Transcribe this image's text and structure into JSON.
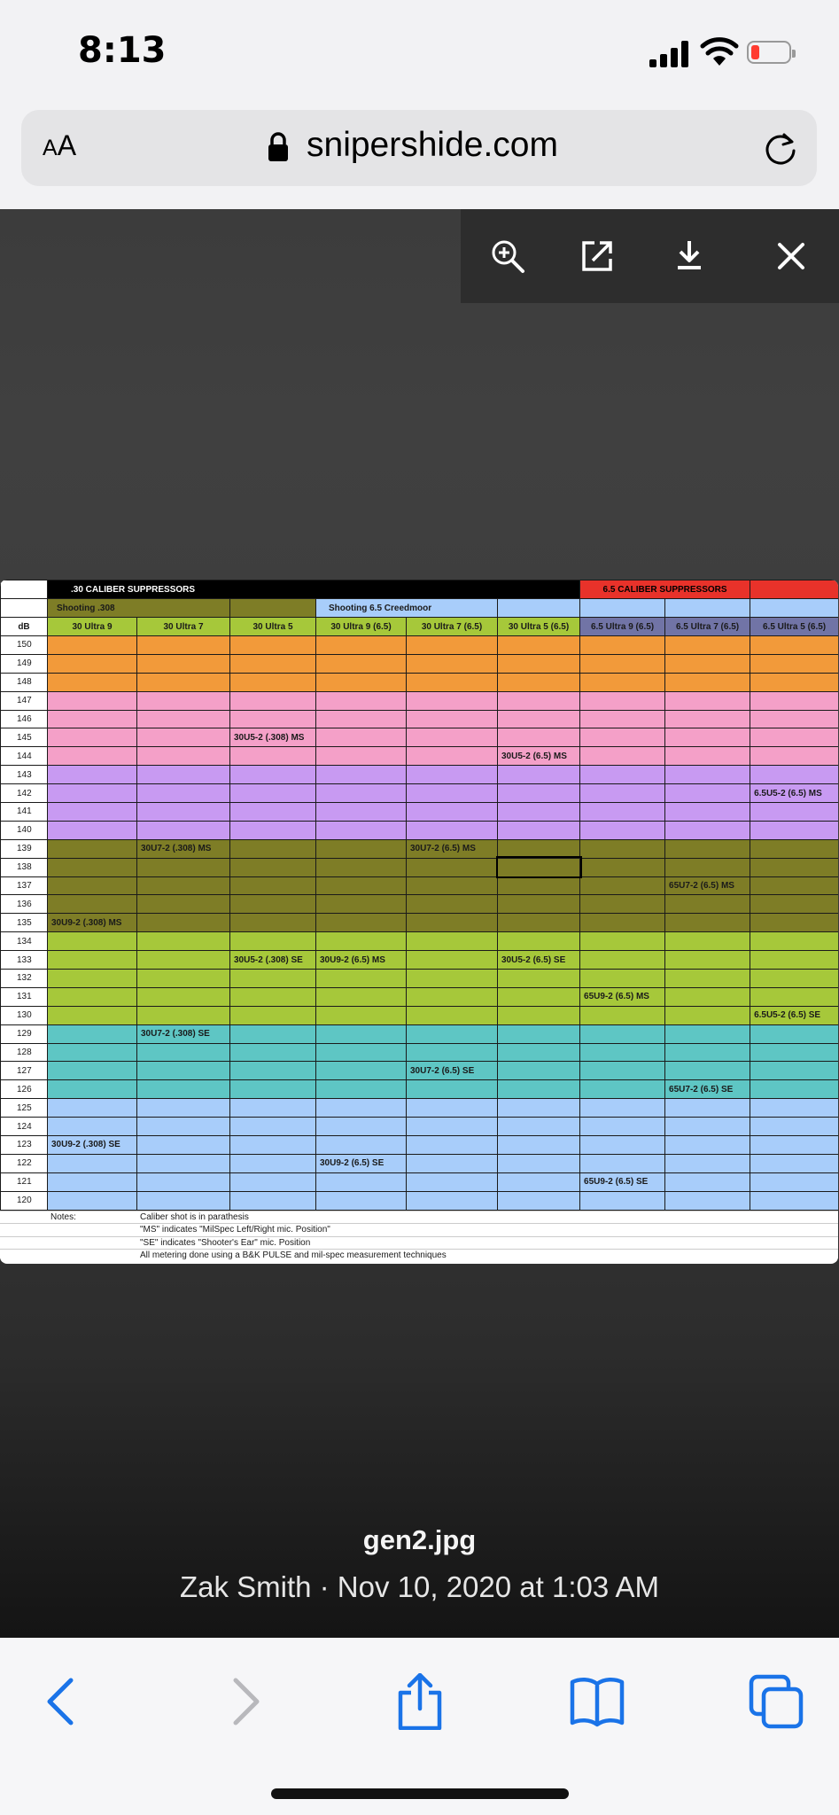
{
  "status": {
    "time": "8:13"
  },
  "browser": {
    "text_size_label": "AA",
    "url": "snipershide.com"
  },
  "viewer": {
    "file_name": "gen2.jpg",
    "meta": "Zak Smith · Nov 10, 2020 at 1:03 AM"
  },
  "sheet": {
    "group_30": ".30 CALIBER SUPPRESSORS",
    "group_65": "6.5 CALIBER SUPPRESSORS",
    "shooting_308": "Shooting .308",
    "shooting_65": "Shooting 6.5 Creedmoor",
    "col_db": "dB",
    "columns": [
      "30 Ultra 9",
      "30 Ultra 7",
      "30 Ultra 5",
      "30 Ultra 9 (6.5)",
      "30 Ultra 7 (6.5)",
      "30 Ultra 5 (6.5)",
      "6.5 Ultra 9 (6.5)",
      "6.5 Ultra 7 (6.5)",
      "6.5 Ultra 5 (6.5)"
    ],
    "rows": [
      {
        "db": "150",
        "c": [
          "",
          "",
          "",
          "",
          "",
          "",
          "",
          "",
          ""
        ]
      },
      {
        "db": "149",
        "c": [
          "",
          "",
          "",
          "",
          "",
          "",
          "",
          "",
          ""
        ]
      },
      {
        "db": "148",
        "c": [
          "",
          "",
          "",
          "",
          "",
          "",
          "",
          "",
          ""
        ]
      },
      {
        "db": "147",
        "c": [
          "",
          "",
          "",
          "",
          "",
          "",
          "",
          "",
          ""
        ]
      },
      {
        "db": "146",
        "c": [
          "",
          "",
          "",
          "",
          "",
          "",
          "",
          "",
          ""
        ]
      },
      {
        "db": "145",
        "c": [
          "",
          "",
          "30U5-2 (.308) MS",
          "",
          "",
          "",
          "",
          "",
          ""
        ]
      },
      {
        "db": "144",
        "c": [
          "",
          "",
          "",
          "",
          "",
          "30U5-2 (6.5) MS",
          "",
          "",
          ""
        ]
      },
      {
        "db": "143",
        "c": [
          "",
          "",
          "",
          "",
          "",
          "",
          "",
          "",
          ""
        ]
      },
      {
        "db": "142",
        "c": [
          "",
          "",
          "",
          "",
          "",
          "",
          "",
          "",
          "6.5U5-2 (6.5) MS"
        ]
      },
      {
        "db": "141",
        "c": [
          "",
          "",
          "",
          "",
          "",
          "",
          "",
          "",
          ""
        ]
      },
      {
        "db": "140",
        "c": [
          "",
          "",
          "",
          "",
          "",
          "",
          "",
          "",
          ""
        ]
      },
      {
        "db": "139",
        "c": [
          "",
          "30U7-2 (.308) MS",
          "",
          "",
          "30U7-2 (6.5) MS",
          "",
          "",
          "",
          ""
        ]
      },
      {
        "db": "138",
        "c": [
          "",
          "",
          "",
          "",
          "",
          "",
          "",
          "",
          ""
        ]
      },
      {
        "db": "137",
        "c": [
          "",
          "",
          "",
          "",
          "",
          "",
          "",
          "65U7-2 (6.5) MS",
          ""
        ]
      },
      {
        "db": "136",
        "c": [
          "",
          "",
          "",
          "",
          "",
          "",
          "",
          "",
          ""
        ]
      },
      {
        "db": "135",
        "c": [
          "30U9-2 (.308) MS",
          "",
          "",
          "",
          "",
          "",
          "",
          "",
          ""
        ]
      },
      {
        "db": "134",
        "c": [
          "",
          "",
          "",
          "",
          "",
          "",
          "",
          "",
          ""
        ]
      },
      {
        "db": "133",
        "c": [
          "",
          "",
          "30U5-2 (.308) SE",
          "30U9-2 (6.5) MS",
          "",
          "30U5-2 (6.5) SE",
          "",
          "",
          ""
        ]
      },
      {
        "db": "132",
        "c": [
          "",
          "",
          "",
          "",
          "",
          "",
          "",
          "",
          ""
        ]
      },
      {
        "db": "131",
        "c": [
          "",
          "",
          "",
          "",
          "",
          "",
          "65U9-2 (6.5) MS",
          "",
          ""
        ]
      },
      {
        "db": "130",
        "c": [
          "",
          "",
          "",
          "",
          "",
          "",
          "",
          "",
          "6.5U5-2 (6.5) SE"
        ]
      },
      {
        "db": "129",
        "c": [
          "",
          "30U7-2 (.308) SE",
          "",
          "",
          "",
          "",
          "",
          "",
          ""
        ]
      },
      {
        "db": "128",
        "c": [
          "",
          "",
          "",
          "",
          "",
          "",
          "",
          "",
          ""
        ]
      },
      {
        "db": "127",
        "c": [
          "",
          "",
          "",
          "",
          "30U7-2 (6.5) SE",
          "",
          "",
          "",
          ""
        ]
      },
      {
        "db": "126",
        "c": [
          "",
          "",
          "",
          "",
          "",
          "",
          "",
          "65U7-2 (6.5) SE",
          ""
        ]
      },
      {
        "db": "125",
        "c": [
          "",
          "",
          "",
          "",
          "",
          "",
          "",
          "",
          ""
        ]
      },
      {
        "db": "124",
        "c": [
          "",
          "",
          "",
          "",
          "",
          "",
          "",
          "",
          ""
        ]
      },
      {
        "db": "123",
        "c": [
          "30U9-2 (.308) SE",
          "",
          "",
          "",
          "",
          "",
          "",
          "",
          ""
        ]
      },
      {
        "db": "122",
        "c": [
          "",
          "",
          "",
          "30U9-2 (6.5) SE",
          "",
          "",
          "",
          "",
          ""
        ]
      },
      {
        "db": "121",
        "c": [
          "",
          "",
          "",
          "",
          "",
          "",
          "65U9-2 (6.5) SE",
          "",
          ""
        ]
      },
      {
        "db": "120",
        "c": [
          "",
          "",
          "",
          "",
          "",
          "",
          "",
          "",
          ""
        ]
      }
    ],
    "notes_label": "Notes:",
    "notes": [
      "Caliber shot is in parathesis",
      "\"MS\" indicates \"MilSpec Left/Right mic. Position\"",
      "\"SE\" indicates \"Shooter's Ear\" mic. Position",
      "All metering done using a B&K PULSE and mil-spec measurement techniques"
    ]
  }
}
